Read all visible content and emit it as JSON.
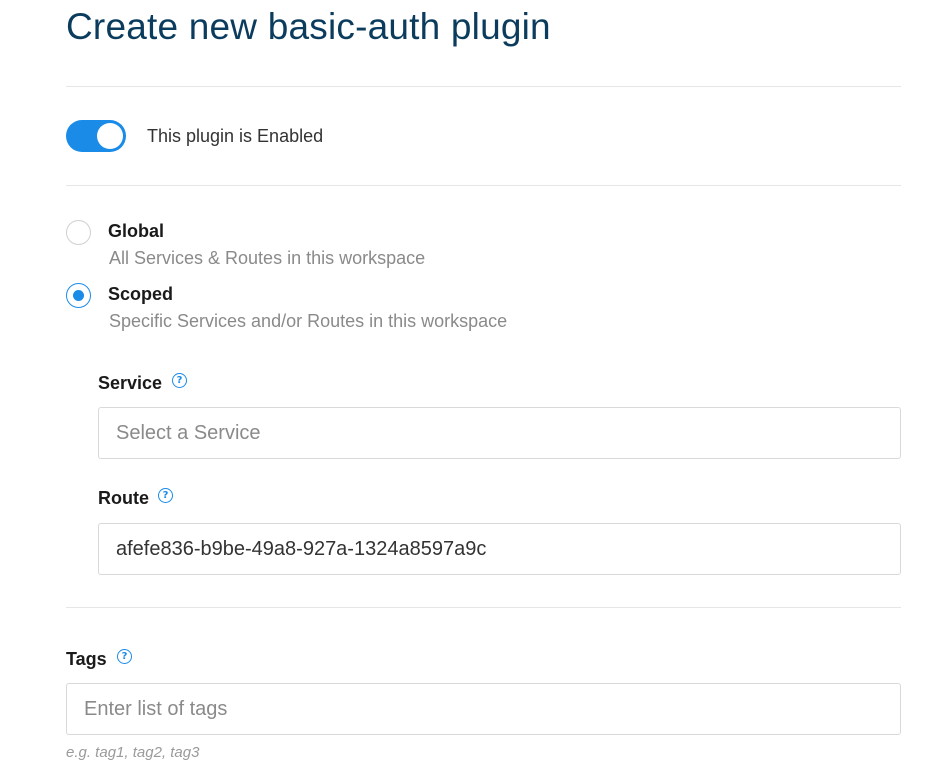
{
  "page": {
    "title": "Create new basic-auth plugin"
  },
  "enabled_toggle": {
    "label": "This plugin is Enabled",
    "on": true
  },
  "scope": {
    "options": [
      {
        "title": "Global",
        "description": "All Services & Routes in this workspace",
        "selected": false
      },
      {
        "title": "Scoped",
        "description": "Specific Services and/or Routes in this workspace",
        "selected": true
      }
    ]
  },
  "service": {
    "label": "Service",
    "placeholder": "Select a Service",
    "value": ""
  },
  "route": {
    "label": "Route",
    "value": "afefe836-b9be-49a8-927a-1324a8597a9c"
  },
  "tags": {
    "label": "Tags",
    "placeholder": "Enter list of tags",
    "hint": "e.g. tag1, tag2, tag3"
  },
  "icons": {
    "help": "?"
  },
  "colors": {
    "accent": "#1b8be8",
    "title": "#0b3c5d",
    "muted_text": "#8a8a8a",
    "border": "#d9d9d9"
  }
}
